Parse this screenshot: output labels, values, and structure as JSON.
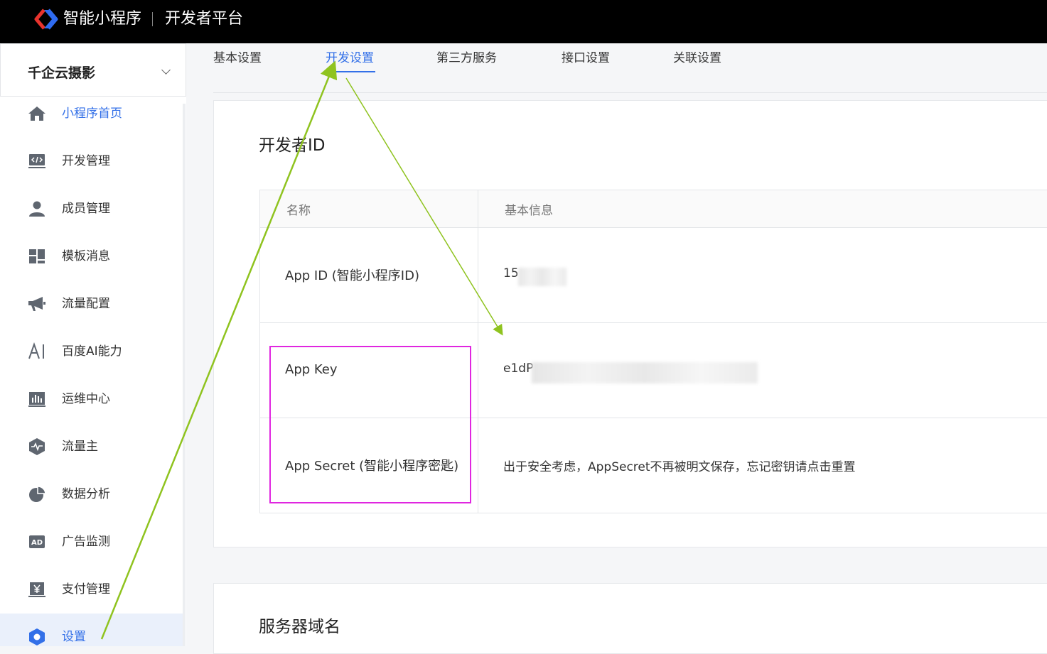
{
  "header": {
    "brand": "智能小程序",
    "platform": "开发者平台",
    "logo_icon": "smart-mini-program-logo-icon"
  },
  "sidebar": {
    "app_name": "千企云摄影",
    "items": [
      {
        "label": "小程序首页",
        "icon": "home-icon"
      },
      {
        "label": "开发管理",
        "icon": "code-icon"
      },
      {
        "label": "成员管理",
        "icon": "user-icon"
      },
      {
        "label": "模板消息",
        "icon": "dashboard-icon"
      },
      {
        "label": "流量配置",
        "icon": "megaphone-icon"
      },
      {
        "label": "百度AI能力",
        "icon": "ai-icon"
      },
      {
        "label": "运维中心",
        "icon": "bar-chart-icon"
      },
      {
        "label": "流量主",
        "icon": "pulse-icon"
      },
      {
        "label": "数据分析",
        "icon": "pie-chart-icon"
      },
      {
        "label": "广告监测",
        "icon": "ad-icon"
      },
      {
        "label": "支付管理",
        "icon": "yen-icon"
      },
      {
        "label": "设置",
        "icon": "settings-icon"
      }
    ],
    "active_index": 11
  },
  "tabs": [
    {
      "label": "基本设置"
    },
    {
      "label": "开发设置"
    },
    {
      "label": "第三方服务"
    },
    {
      "label": "接口设置"
    },
    {
      "label": "关联设置"
    }
  ],
  "active_tab": 1,
  "developer_id": {
    "title": "开发者ID",
    "headers": {
      "name": "名称",
      "info": "基本信息"
    },
    "rows": [
      {
        "name": "App ID (智能小程序ID)",
        "value": "15"
      },
      {
        "name": "App Key",
        "value": "e1dP"
      },
      {
        "name": "App Secret (智能小程序密匙)",
        "value": "出于安全考虑，AppSecret不再被明文保存，忘记密钥请点击重置"
      }
    ]
  },
  "server_domain": {
    "title": "服务器域名"
  },
  "colors": {
    "accent": "#3370e8",
    "annotation_arrow": "#8fc31f",
    "highlight_box": "#e026e0"
  }
}
